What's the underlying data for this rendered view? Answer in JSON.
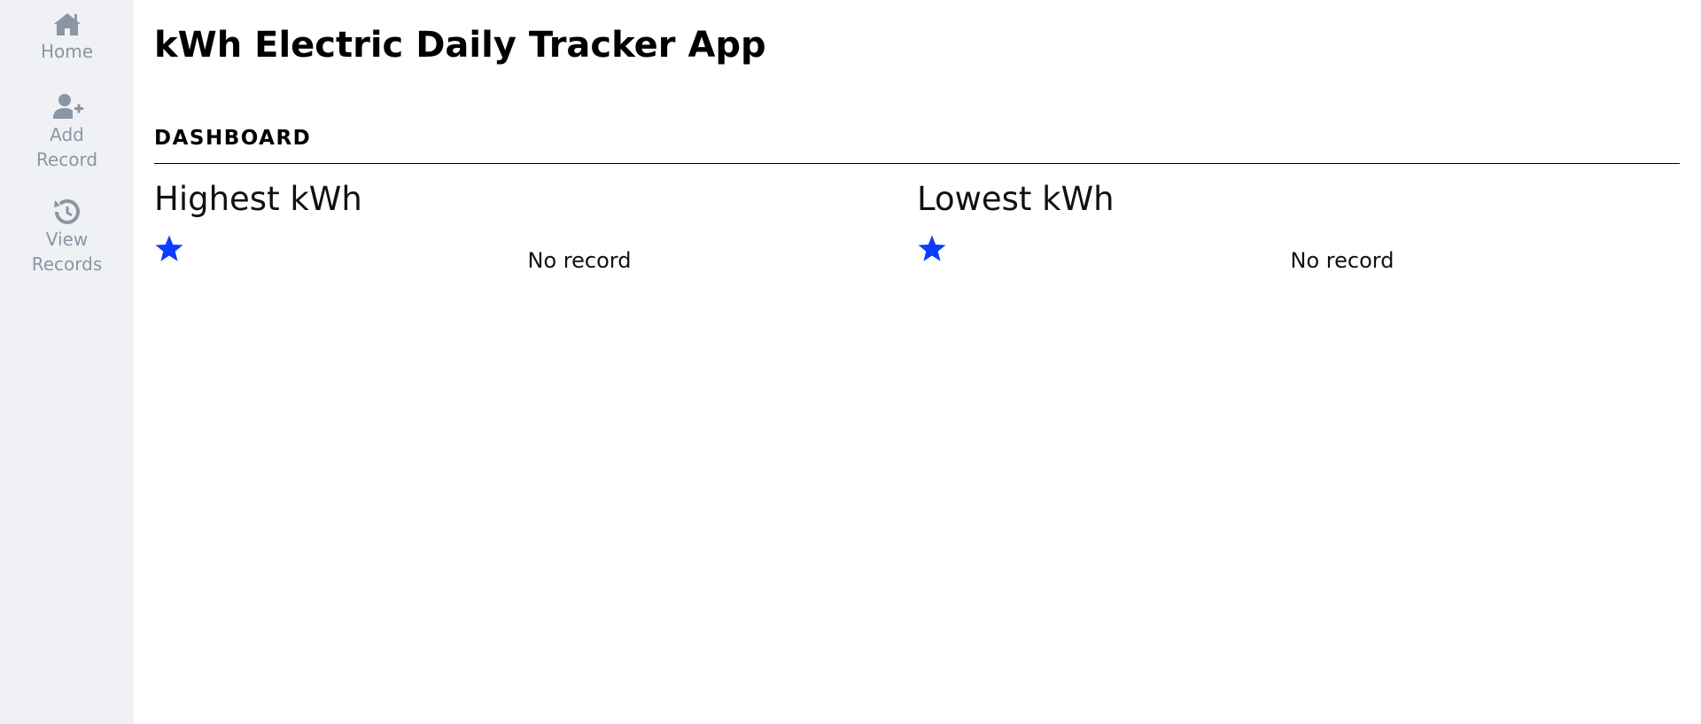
{
  "app": {
    "title": "kWh Electric Daily Tracker App"
  },
  "sidebar": {
    "items": [
      {
        "label": "Home",
        "icon": "home-icon"
      },
      {
        "label": "Add\nRecord",
        "icon": "add-user-icon"
      },
      {
        "label": "View\nRecords",
        "icon": "history-icon"
      }
    ]
  },
  "dashboard": {
    "heading": "DASHBOARD",
    "highest": {
      "title": "Highest kWh",
      "icon": "star-icon",
      "value": "No record"
    },
    "lowest": {
      "title": "Lowest kWh",
      "icon": "star-icon",
      "value": "No record"
    }
  },
  "colors": {
    "sidebar_bg": "#eff1f5",
    "sidebar_text": "#8a96a3",
    "star": "#0d3bff"
  }
}
